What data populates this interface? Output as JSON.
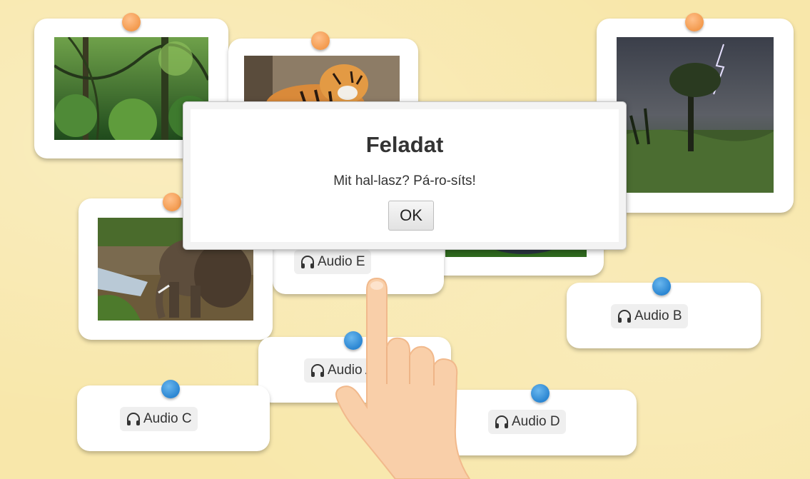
{
  "dialog": {
    "title": "Feladat",
    "message": "Mit hal-lasz? Pá-ro-síts!",
    "ok_label": "OK"
  },
  "audio_cards": {
    "a": "Audio A",
    "b": "Audio B",
    "c": "Audio C",
    "d": "Audio D",
    "e": "Audio E"
  },
  "image_cards": [
    "jungle",
    "tiger",
    "storm",
    "elephant",
    "gorilla"
  ],
  "icons": {
    "audio": "headphones-icon",
    "pin_image": "orange-pin-icon",
    "pin_audio": "blue-pin-icon"
  },
  "colors": {
    "background": "#f8e7aa",
    "pin_orange": "#f39a4e",
    "pin_blue": "#2b86d2"
  }
}
